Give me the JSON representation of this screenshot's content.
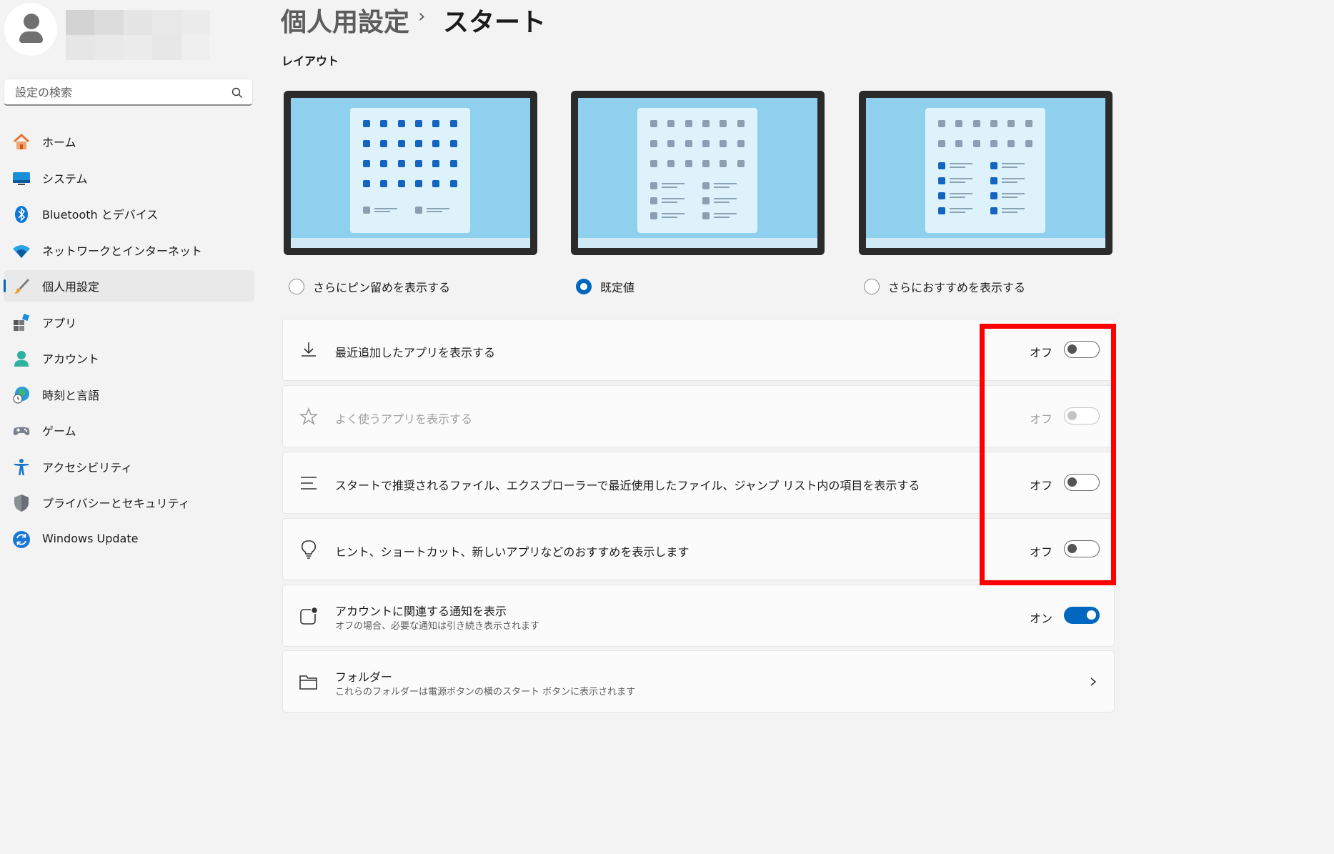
{
  "search": {
    "placeholder": "設定の検索"
  },
  "sidebar": {
    "items": [
      {
        "label": "ホーム",
        "icon": "home-icon"
      },
      {
        "label": "システム",
        "icon": "system-icon"
      },
      {
        "label": "Bluetooth とデバイス",
        "icon": "bluetooth-icon"
      },
      {
        "label": "ネットワークとインターネット",
        "icon": "wifi-icon"
      },
      {
        "label": "個人用設定",
        "icon": "brush-icon",
        "active": true
      },
      {
        "label": "アプリ",
        "icon": "apps-icon"
      },
      {
        "label": "アカウント",
        "icon": "account-icon"
      },
      {
        "label": "時刻と言語",
        "icon": "globe-clock-icon"
      },
      {
        "label": "ゲーム",
        "icon": "gamepad-icon"
      },
      {
        "label": "アクセシビリティ",
        "icon": "accessibility-icon"
      },
      {
        "label": "プライバシーとセキュリティ",
        "icon": "shield-icon"
      },
      {
        "label": "Windows Update",
        "icon": "update-icon"
      }
    ]
  },
  "header": {
    "breadcrumb": "個人用設定",
    "separator": "›",
    "title": "スタート"
  },
  "layout": {
    "heading": "レイアウト",
    "options": [
      {
        "label": "さらにピン留めを表示する",
        "selected": false
      },
      {
        "label": "既定値",
        "selected": true
      },
      {
        "label": "さらにおすすめを表示する",
        "selected": false
      }
    ]
  },
  "settings": [
    {
      "title": "最近追加したアプリを表示する",
      "state": "オフ",
      "on": false,
      "disabled": false,
      "icon": "download-icon"
    },
    {
      "title": "よく使うアプリを表示する",
      "state": "オフ",
      "on": false,
      "disabled": true,
      "icon": "star-icon"
    },
    {
      "title": "スタートで推奨されるファイル、エクスプローラーで最近使用したファイル、ジャンプ リスト内の項目を表示する",
      "state": "オフ",
      "on": false,
      "disabled": false,
      "icon": "list-icon"
    },
    {
      "title": "ヒント、ショートカット、新しいアプリなどのおすすめを表示します",
      "state": "オフ",
      "on": false,
      "disabled": false,
      "icon": "lightbulb-icon"
    },
    {
      "title": "アカウントに関連する通知を表示",
      "subtitle": "オフの場合、必要な通知は引き続き表示されます",
      "state": "オン",
      "on": true,
      "disabled": false,
      "icon": "notification-icon"
    },
    {
      "title": "フォルダー",
      "subtitle": "これらのフォルダーは電源ボタンの横のスタート ボタンに表示されます",
      "icon": "folder-icon"
    }
  ],
  "colors": {
    "accent": "#0067c0",
    "highlight": "#ff0000",
    "pinned_dot": "#1565c0",
    "muted_dot": "#8aa0b2"
  }
}
